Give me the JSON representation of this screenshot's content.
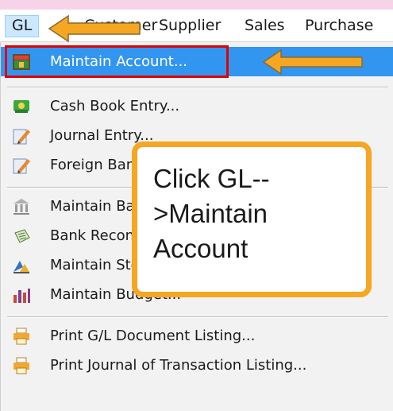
{
  "menubar": {
    "items": [
      {
        "label": "GL"
      },
      {
        "label": "Customer"
      },
      {
        "label": "Supplier"
      },
      {
        "label": "Sales"
      },
      {
        "label": "Purchase"
      }
    ]
  },
  "dropdown": {
    "items": [
      {
        "label": "Maintain Account...",
        "icon": "account-book-icon"
      },
      {
        "label": "Cash Book Entry...",
        "icon": "cash-book-icon"
      },
      {
        "label": "Journal Entry...",
        "icon": "journal-pen-icon"
      },
      {
        "label": "Foreign Bank Entry...",
        "icon": "journal-pen-icon"
      },
      {
        "label": "Maintain Bank...",
        "icon": "bank-icon"
      },
      {
        "label": "Bank Reconciliation...",
        "icon": "bank-rec-icon"
      },
      {
        "label": "Maintain Stock Value...",
        "icon": "stock-value-icon"
      },
      {
        "label": "Maintain Budget...",
        "icon": "budget-chart-icon"
      },
      {
        "label": "Print G/L Document Listing...",
        "icon": "printer-icon"
      },
      {
        "label": "Print Journal of Transaction Listing...",
        "icon": "printer-icon"
      }
    ]
  },
  "callout": {
    "line1": "Click GL--",
    "line2": ">Maintain",
    "line3": "Account"
  },
  "colors": {
    "highlight": "#3296f0",
    "annotation_arrow": "#f5a623",
    "annotation_box": "#e00000"
  }
}
